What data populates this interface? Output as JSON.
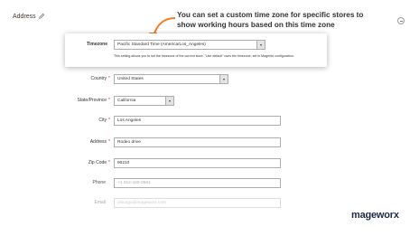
{
  "section": {
    "title": "Address"
  },
  "annotation": {
    "text": "You can set a custom time zone for specific stores to show working hours based on this time zone"
  },
  "popup": {
    "label": "Timezone",
    "value": "Pacific Standard Time (America/Los_Angeles)",
    "note": "This setting allows you to set the timezone of the current store. \"Use default\" uses the timezone, set in Magento configuration."
  },
  "form": {
    "country": {
      "label": "Country",
      "value": "United States",
      "required": "*"
    },
    "state": {
      "label": "State/Province",
      "value": "California",
      "required": "*"
    },
    "city": {
      "label": "City",
      "value": "Los Angeles",
      "required": "*"
    },
    "address": {
      "label": "Address",
      "value": "Rodeo drive",
      "required": "*"
    },
    "zip": {
      "label": "Zip Code",
      "value": "90210",
      "required": "*"
    },
    "phone": {
      "label": "Phone",
      "value": "+1 312-440-0581"
    },
    "email": {
      "label": "Email",
      "value": "chicago@mageworx.com"
    }
  },
  "brand": {
    "name": "mageworx"
  },
  "colors": {
    "required": "#e22626",
    "brand": "#1f2a44",
    "arrow": "#f47b20"
  }
}
